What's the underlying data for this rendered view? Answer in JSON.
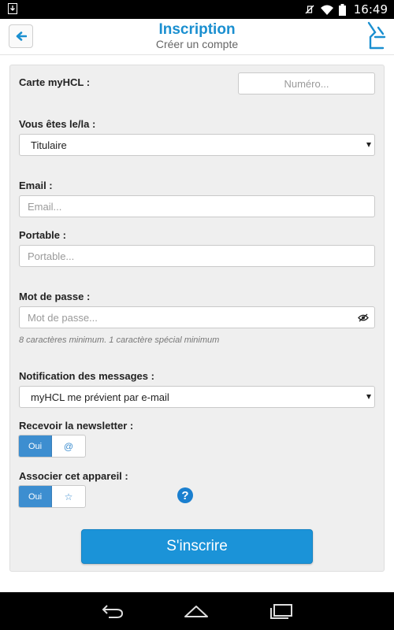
{
  "status_bar": {
    "time": "16:49"
  },
  "header": {
    "title": "Inscription",
    "subtitle": "Créer un compte"
  },
  "form": {
    "card_label": "Carte myHCL :",
    "card_placeholder": "Numéro...",
    "role_label": "Vous êtes le/la :",
    "role_value": "Titulaire",
    "email_label": "Email :",
    "email_placeholder": "Email...",
    "mobile_label": "Portable :",
    "mobile_placeholder": "Portable...",
    "password_label": "Mot de passe :",
    "password_placeholder": "Mot de passe...",
    "password_hint": "8 caractères minimum. 1 caractère spécial minimum",
    "notification_label": "Notification des messages :",
    "notification_value": "myHCL me prévient par e-mail",
    "newsletter_label": "Recevoir la newsletter :",
    "newsletter_on": "Oui",
    "newsletter_icon": "@",
    "device_label": "Associer cet appareil :",
    "device_on": "Oui",
    "device_icon": "☆",
    "help_icon": "?",
    "submit_label": "S'inscrire"
  },
  "colors": {
    "accent": "#1b93d8",
    "toggle_on": "#3d8ed0"
  }
}
